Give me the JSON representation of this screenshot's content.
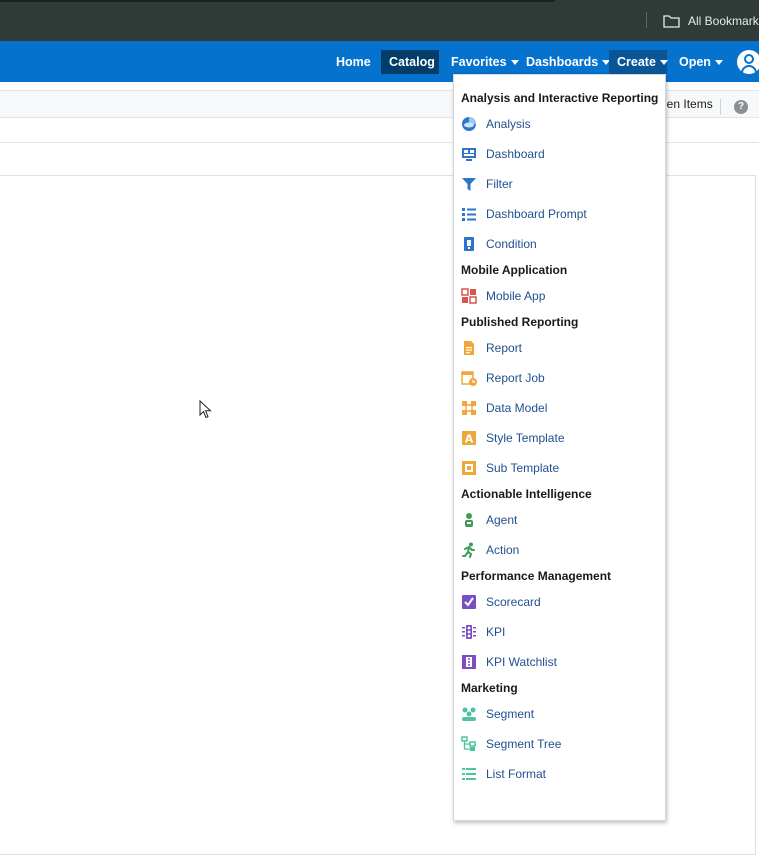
{
  "browser": {
    "bookmarks_label": "All Bookmarks"
  },
  "header": {
    "nav": [
      {
        "label": "Home",
        "has_caret": false,
        "state": "normal"
      },
      {
        "label": "Catalog",
        "has_caret": false,
        "state": "selected"
      },
      {
        "label": "Favorites",
        "has_caret": true,
        "state": "normal"
      },
      {
        "label": "Dashboards",
        "has_caret": true,
        "state": "normal"
      },
      {
        "label": "Create",
        "has_caret": true,
        "state": "active"
      },
      {
        "label": "Open",
        "has_caret": true,
        "state": "normal"
      }
    ],
    "colors": {
      "bar": "#0572ce",
      "selected": "#033e6b",
      "active": "#0a5596"
    }
  },
  "toolbar": {
    "hidden_items_label": "den Items",
    "help_icon_glyph": "?"
  },
  "create_menu": {
    "sections": [
      {
        "title": "Analysis and Interactive Reporting",
        "items": [
          {
            "label": "Analysis",
            "icon": "analysis-icon"
          },
          {
            "label": "Dashboard",
            "icon": "dashboard-icon"
          },
          {
            "label": "Filter",
            "icon": "filter-icon"
          },
          {
            "label": "Dashboard Prompt",
            "icon": "dashboard-prompt-icon"
          },
          {
            "label": "Condition",
            "icon": "condition-icon"
          }
        ]
      },
      {
        "title": "Mobile Application",
        "items": [
          {
            "label": "Mobile App",
            "icon": "mobile-app-icon"
          }
        ]
      },
      {
        "title": "Published Reporting",
        "items": [
          {
            "label": "Report",
            "icon": "report-icon"
          },
          {
            "label": "Report Job",
            "icon": "report-job-icon"
          },
          {
            "label": "Data Model",
            "icon": "data-model-icon"
          },
          {
            "label": "Style Template",
            "icon": "style-template-icon"
          },
          {
            "label": "Sub Template",
            "icon": "sub-template-icon"
          }
        ]
      },
      {
        "title": "Actionable Intelligence",
        "items": [
          {
            "label": "Agent",
            "icon": "agent-icon"
          },
          {
            "label": "Action",
            "icon": "action-icon"
          }
        ]
      },
      {
        "title": "Performance Management",
        "items": [
          {
            "label": "Scorecard",
            "icon": "scorecard-icon"
          },
          {
            "label": "KPI",
            "icon": "kpi-icon"
          },
          {
            "label": "KPI Watchlist",
            "icon": "kpi-watchlist-icon"
          }
        ]
      },
      {
        "title": "Marketing",
        "items": [
          {
            "label": "Segment",
            "icon": "segment-icon"
          },
          {
            "label": "Segment Tree",
            "icon": "segment-tree-icon"
          },
          {
            "label": "List Format",
            "icon": "list-format-icon"
          }
        ]
      }
    ],
    "colors": {
      "label": "#22508f",
      "blue": "#2e74c9",
      "orange": "#f0a73a",
      "green": "#3f9c5a",
      "purple": "#7a4fc2",
      "teal": "#4fc3a1",
      "red": "#d9534f"
    }
  }
}
